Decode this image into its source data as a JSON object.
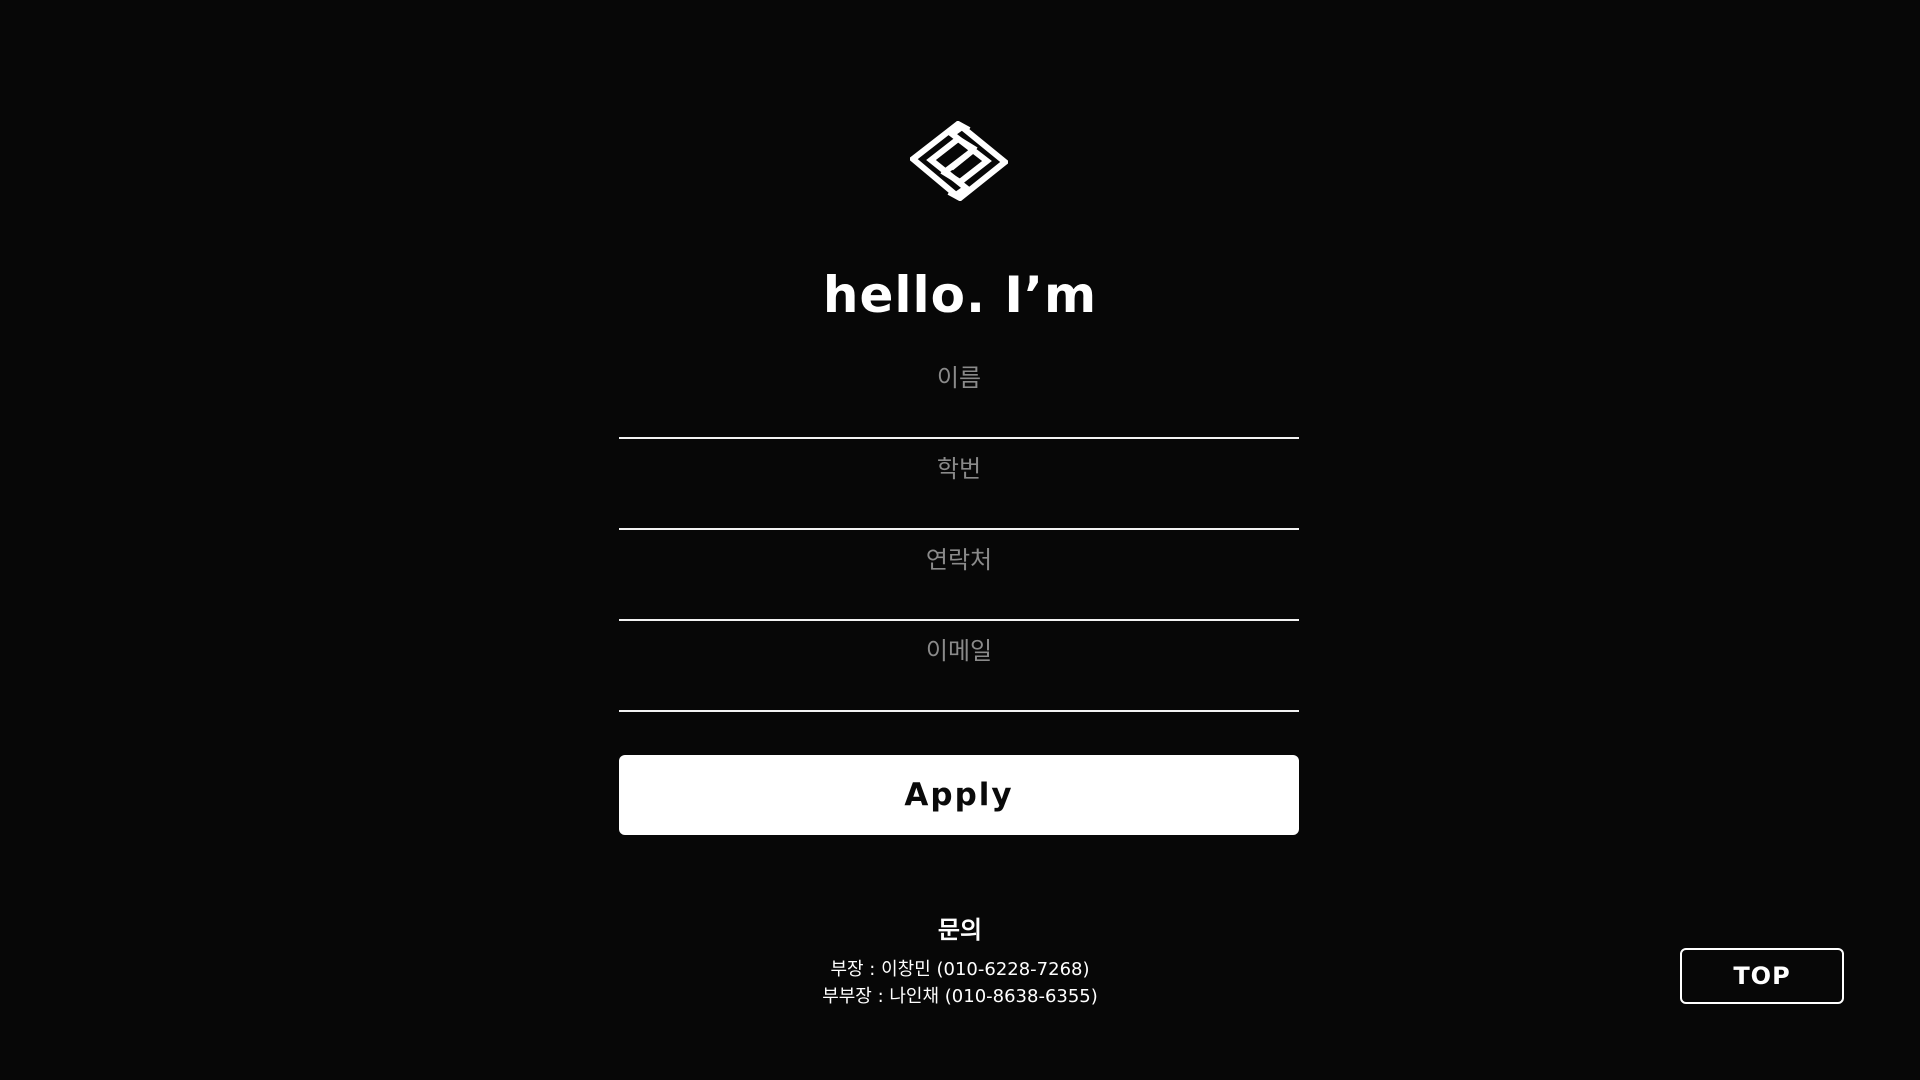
{
  "brand": {
    "logo_icon": "diamond-s-logo-icon"
  },
  "headline": "hello. I’m",
  "form": {
    "fields": [
      {
        "placeholder": "이름",
        "value": ""
      },
      {
        "placeholder": "학번",
        "value": ""
      },
      {
        "placeholder": "연락처",
        "value": ""
      },
      {
        "placeholder": "이메일",
        "value": ""
      }
    ],
    "submit_label": "Apply"
  },
  "contact": {
    "title": "문의",
    "lines": [
      "부장 : 이창민 (010-6228-7268)",
      "부부장 : 나인채 (010-8638-6355)"
    ]
  },
  "top_button": {
    "label": "TOP"
  },
  "colors": {
    "background": "#070707",
    "foreground": "#ffffff",
    "placeholder": "#8a8a8a",
    "button_text": "#0a0a0a"
  }
}
